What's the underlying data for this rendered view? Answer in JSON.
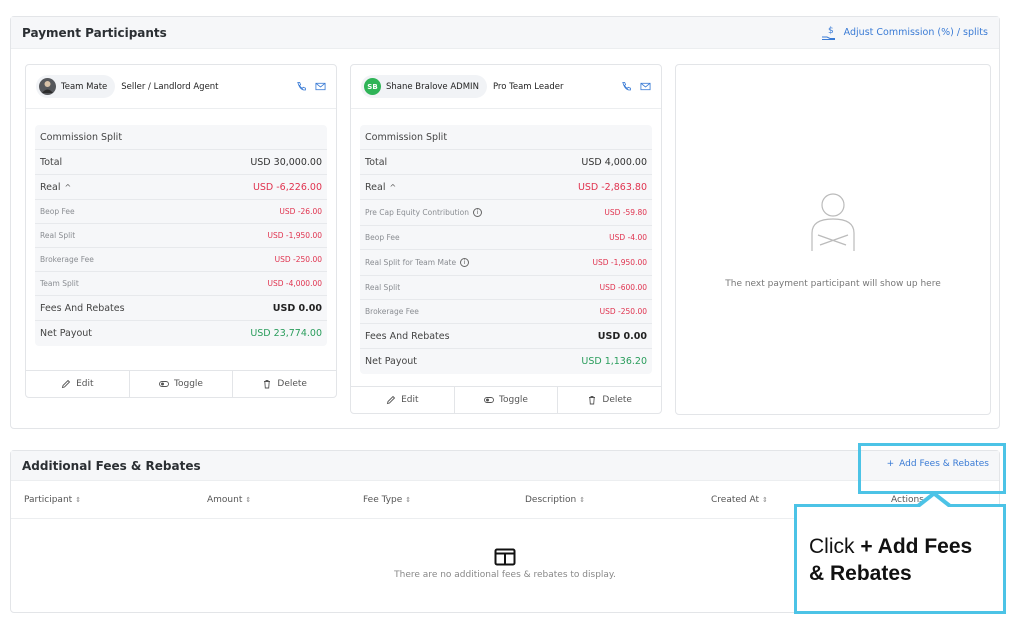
{
  "payment_participants": {
    "title": "Payment Participants",
    "adjust_link": "Adjust Commission (%) / splits",
    "cards": [
      {
        "chip_name": "Team Mate",
        "role": "Seller / Landlord Agent",
        "split_header": "Commission Split",
        "total_label": "Total",
        "total_value": "USD 30,000.00",
        "real_label": "Real",
        "real_value": "USD -6,226.00",
        "sub_rows": [
          {
            "label": "Beop Fee",
            "value": "USD -26.00"
          },
          {
            "label": "Real Split",
            "value": "USD -1,950.00"
          },
          {
            "label": "Brokerage Fee",
            "value": "USD -250.00"
          },
          {
            "label": "Team Split",
            "value": "USD -4,000.00"
          }
        ],
        "fees_label": "Fees And Rebates",
        "fees_value": "USD 0.00",
        "net_label": "Net Payout",
        "net_value": "USD 23,774.00"
      },
      {
        "chip_initials": "SB",
        "chip_name": "Shane Bralove ADMIN",
        "role": "Pro Team Leader",
        "split_header": "Commission Split",
        "total_label": "Total",
        "total_value": "USD 4,000.00",
        "real_label": "Real",
        "real_value": "USD -2,863.80",
        "sub_rows": [
          {
            "label": "Pre Cap Equity Contribution",
            "value": "USD -59.80"
          },
          {
            "label": "Beop Fee",
            "value": "USD -4.00"
          },
          {
            "label": "Real Split for Team Mate",
            "value": "USD -1,950.00"
          },
          {
            "label": "Real Split",
            "value": "USD -600.00"
          },
          {
            "label": "Brokerage Fee",
            "value": "USD -250.00"
          }
        ],
        "fees_label": "Fees And Rebates",
        "fees_value": "USD 0.00",
        "net_label": "Net Payout",
        "net_value": "USD 1,136.20"
      }
    ],
    "actions": {
      "edit": "Edit",
      "toggle": "Toggle",
      "delete": "Delete"
    },
    "empty_participant_text": "The next payment participant will show up here"
  },
  "additional_fees": {
    "title": "Additional Fees & Rebates",
    "add_link": "Add Fees & Rebates",
    "columns": [
      "Participant",
      "Amount",
      "Fee Type",
      "Description",
      "Created At",
      "Actions"
    ],
    "empty_text": "There are no additional fees & rebates to display."
  },
  "callout": {
    "prefix": "Click ",
    "bold": "+ Add Fees & Rebates"
  },
  "colors": {
    "accent": "#3a7bd5",
    "negative": "#e0334f",
    "positive": "#2a9d5c",
    "highlight": "#4cc3e6"
  }
}
